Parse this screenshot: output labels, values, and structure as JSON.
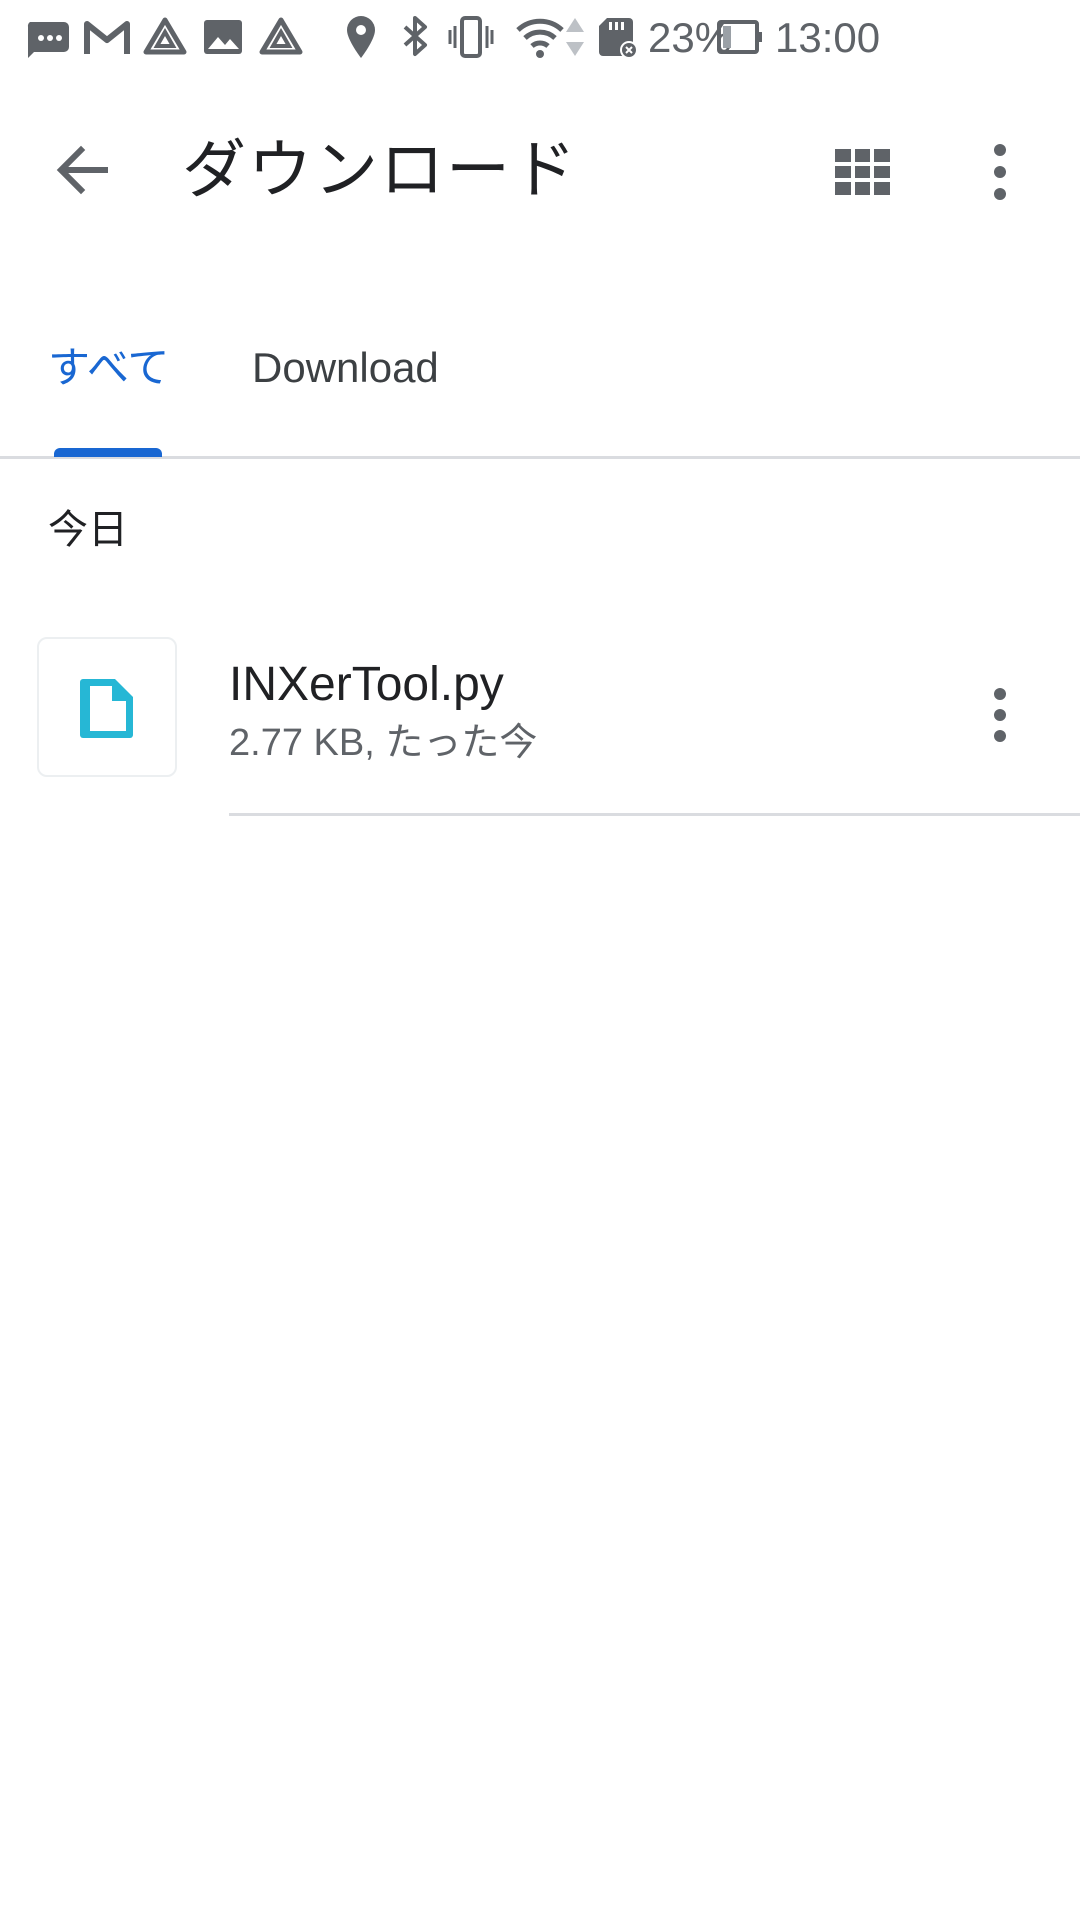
{
  "status_bar": {
    "battery_percent": "23%",
    "time": "13:00",
    "icons": [
      "messages-icon",
      "gmail-icon",
      "drive-icon",
      "image-icon",
      "drive-icon",
      "location-icon",
      "bluetooth-icon",
      "vibrate-icon",
      "wifi-icon",
      "data-arrows-icon",
      "sd-card-icon",
      "battery-icon"
    ]
  },
  "appbar": {
    "title": "ダウンロード",
    "back_icon": "arrow-back-icon",
    "grid_icon": "grid-view-icon",
    "more_icon": "more-vert-icon"
  },
  "tabs": [
    {
      "label": "すべて",
      "selected": true
    },
    {
      "label": "Download",
      "selected": false
    }
  ],
  "section_header": "今日",
  "files": [
    {
      "name": "INXerTool.py",
      "meta": "2.77 KB, たった今",
      "icon": "file-icon"
    }
  ],
  "colors": {
    "accent": "#1967d2",
    "file_icon": "#26b7d5",
    "text_secondary": "#5f6368",
    "divider": "#dadce0"
  }
}
